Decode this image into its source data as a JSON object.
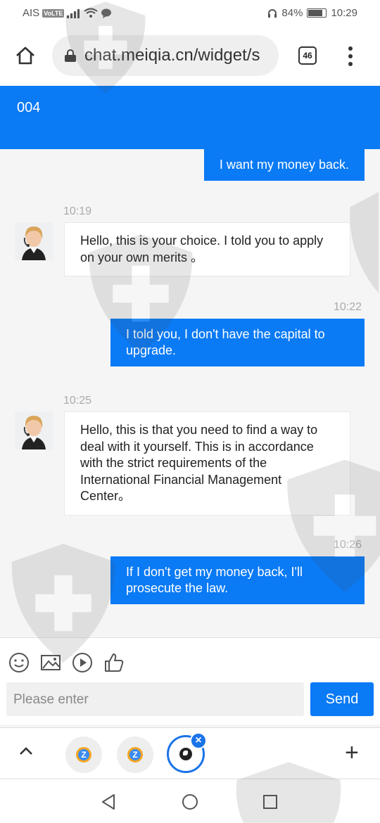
{
  "status_bar": {
    "carrier": "AIS",
    "volte": "VoLTE",
    "battery": "84%",
    "time": "10:29"
  },
  "browser": {
    "url": "chat.meiqia.cn/widget/s",
    "tab_count": "46"
  },
  "chat": {
    "header_title": "004",
    "messages": [
      {
        "side": "out",
        "text": "I want my money back."
      },
      {
        "side": "in",
        "time": "10:19",
        "text": "Hello, this is your choice. I told you to apply on your own merits 。"
      },
      {
        "side": "out",
        "time": "10:22",
        "text": "I told you, I don't have the capital to upgrade."
      },
      {
        "side": "in",
        "time": "10:25",
        "text": "Hello, this is that you need to find a way to deal with it yourself. This is in accordance with the strict requirements of the International Financial Management Center。"
      },
      {
        "side": "out",
        "time": "10:26",
        "text": "If I don't get my money back, I'll prosecute the law."
      }
    ]
  },
  "composer": {
    "placeholder": "Please enter",
    "send_label": "Send",
    "tools": [
      "emoji-icon",
      "image-icon",
      "video-icon",
      "thumbs-up-icon"
    ]
  },
  "tab_strip": {
    "favicon_letter": "Z"
  },
  "colors": {
    "accent": "#0a7af5",
    "watermark": "#4a4a4a"
  }
}
